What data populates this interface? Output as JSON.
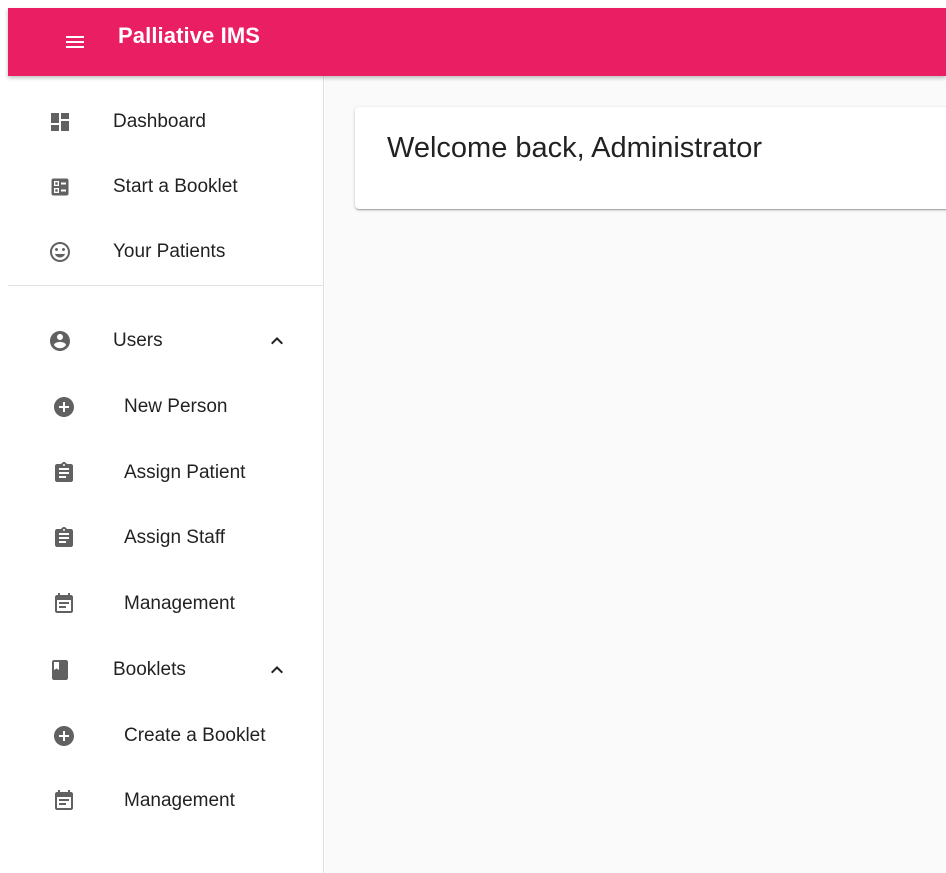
{
  "appbar": {
    "title": "Palliative IMS",
    "menu_icon": "menu-icon",
    "color": "#e91e63"
  },
  "sidebar": {
    "items": [
      {
        "label": "Dashboard",
        "icon": "dashboard-icon"
      },
      {
        "label": "Start a Booklet",
        "icon": "booklet-form-icon"
      },
      {
        "label": "Your Patients",
        "icon": "smiley-face-icon"
      }
    ],
    "groups": [
      {
        "label": "Users",
        "icon": "account-circle-icon",
        "expanded_icon": "chevron-up-icon",
        "children": [
          {
            "label": "New Person",
            "icon": "add-circle-icon"
          },
          {
            "label": "Assign Patient",
            "icon": "assignment-icon"
          },
          {
            "label": "Assign Staff",
            "icon": "assignment-icon"
          },
          {
            "label": "Management",
            "icon": "event-note-icon"
          }
        ]
      },
      {
        "label": "Booklets",
        "icon": "book-icon",
        "expanded_icon": "chevron-up-icon",
        "children": [
          {
            "label": "Create a Booklet",
            "icon": "add-circle-icon"
          },
          {
            "label": "Management",
            "icon": "event-note-icon"
          }
        ]
      }
    ]
  },
  "main": {
    "welcome": "Welcome back, Administrator"
  }
}
